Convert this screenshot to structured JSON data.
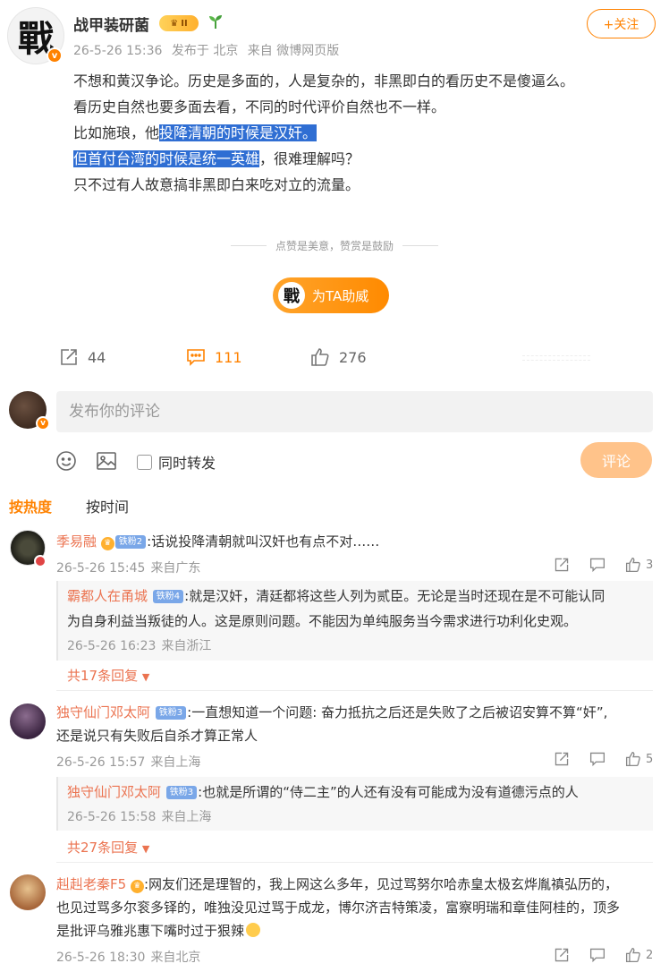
{
  "post": {
    "author": "战甲装研菌",
    "avatar_glyph": "戰",
    "verified_glyph": "v",
    "crown_level": "II",
    "time": "26-5-26 15:36",
    "location": "发布于 北京",
    "source": "来自 微博网页版",
    "follow_label": "+关注",
    "lines": {
      "l1": "不想和黄汉争论。历史是多面的，人是复杂的，非黑即白的看历史不是傻逼么。",
      "l2": "看历史自然也要多面去看，不同的时代评价自然也不一样。",
      "l3_pre": "比如施琅，他",
      "l3_hl": "投降清朝的时候是汉奸。",
      "l4_hl": "但首付台湾的时候是统一英雄",
      "l4_post": "，很难理解吗？",
      "l5": "只不过有人故意搞非黑即白来吃对立的流量。"
    },
    "appreciate_text": "点赞是美意，赞赏是鼓励",
    "reward_label": "为TA助威",
    "reposts": "44",
    "comments": "111",
    "likes": "276"
  },
  "composer": {
    "placeholder": "发布你的评论",
    "repost_label": "同时转发",
    "submit_label": "评论"
  },
  "sort_tabs": {
    "hot": "按热度",
    "time": "按时间"
  },
  "comments": [
    {
      "user": "季易融",
      "badge": "铁粉2",
      "text": ":话说投降清朝就叫汉奸也有点不对……",
      "time": "26-5-26 15:45",
      "location": "来自广东",
      "likes": "3",
      "reply": {
        "user": "霸都人在甬城",
        "badge": "铁粉4",
        "text1": ":就是汉奸，清廷都将这些人列为贰臣。无论是当时还现在是不可能认同",
        "text2": "为自身利益当叛徒的人。这是原则问题。不能因为单纯服务当今需求进行功利化史观。",
        "time": "26-5-26 16:23",
        "location": "来自浙江"
      },
      "more": "共17条回复"
    },
    {
      "user": "独守仙门邓太阿",
      "badge": "铁粉3",
      "text1": ":一直想知道一个问题: 奋力抵抗之后还是失败了之后被诏安算不算“奸”,",
      "text2": "还是说只有失败后自杀才算正常人",
      "time": "26-5-26 15:57",
      "location": "来自上海",
      "likes": "5",
      "reply": {
        "user": "独守仙门邓太阿",
        "badge": "铁粉3",
        "text": ":也就是所谓的“侍二主”的人还有没有可能成为没有道德污点的人",
        "time": "26-5-26 15:58",
        "location": "来自上海"
      },
      "more": "共27条回复"
    },
    {
      "user": "赳赳老秦F5",
      "text1": ":网友们还是理智的，我上网这么多年，见过骂努尔哈赤皇太极玄烨胤禛弘历的，",
      "text2": "也见过骂多尔衮多铎的，唯独没见过骂于成龙，博尔济吉特策凌，富察明瑞和章佳阿桂的，顶多",
      "text3": "是批评乌雅兆惠下嘴时过于狠辣",
      "time": "26-5-26 18:30",
      "location": "来自北京",
      "likes": "2"
    }
  ],
  "colors": {
    "accent": "#ff8200",
    "username": "#eb7350",
    "highlight": "#2f6ed3"
  },
  "icons": [
    "repost-icon",
    "comment-icon",
    "like-icon",
    "emoji-icon",
    "image-icon",
    "share-icon",
    "reply-icon",
    "thumb-icon"
  ]
}
